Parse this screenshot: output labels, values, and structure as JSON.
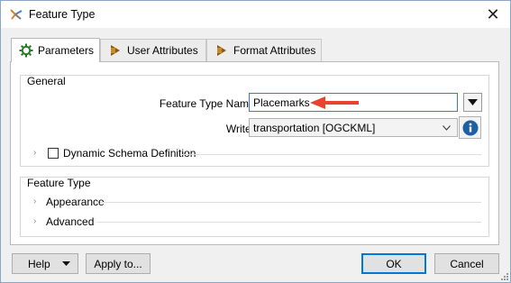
{
  "window": {
    "title": "Feature Type",
    "close_symbol": "✕"
  },
  "tabs": [
    {
      "label": "Parameters",
      "icon": "gear-icon",
      "active": true
    },
    {
      "label": "User Attributes",
      "icon": "arrow-right-icon",
      "active": false
    },
    {
      "label": "Format Attributes",
      "icon": "arrow-right-icon",
      "active": false
    }
  ],
  "general": {
    "title": "General",
    "feature_type_name_label": "Feature Type Name:",
    "feature_type_name_value": "Placemarks",
    "writer_label": "Writer:",
    "writer_value": "transportation [OGCKML]",
    "dynamic_schema_label": "Dynamic Schema Definition",
    "dynamic_schema_checked": false
  },
  "feature_type_section": {
    "title": "Feature Type",
    "appearance_label": "Appearance",
    "advanced_label": "Advanced"
  },
  "buttons": {
    "help": "Help",
    "apply_to": "Apply to...",
    "ok": "OK",
    "cancel": "Cancel"
  },
  "colors": {
    "annotation_arrow": "#e8432f",
    "info_button": "#1f5fa6",
    "focus_border": "#3b79c9"
  }
}
